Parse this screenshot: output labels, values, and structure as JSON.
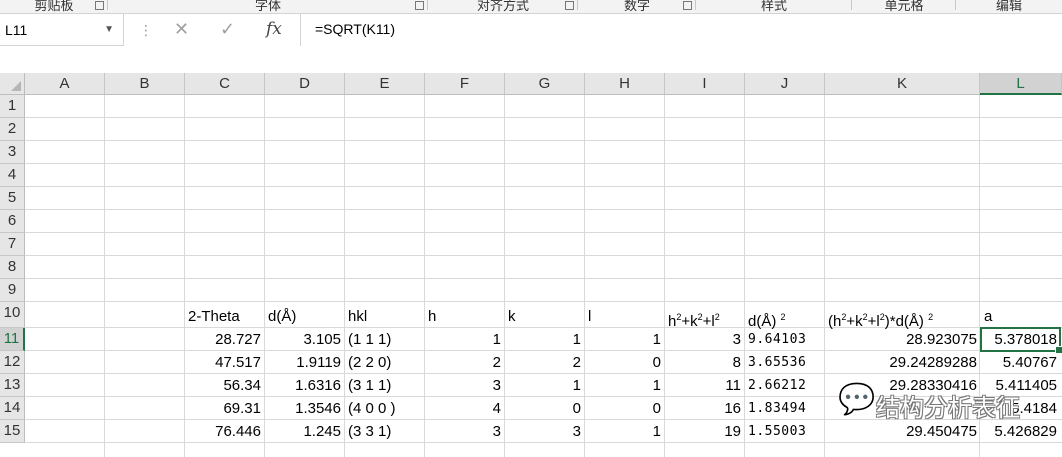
{
  "ribbon": {
    "groups": [
      {
        "label": "剪贴板"
      },
      {
        "label": "字体"
      },
      {
        "label": "对齐方式"
      },
      {
        "label": "数字"
      },
      {
        "label": "样式"
      },
      {
        "label": "单元格"
      },
      {
        "label": "编辑"
      }
    ]
  },
  "formula_bar": {
    "name_box": "L11",
    "formula": "=SQRT(K11)"
  },
  "columns": [
    "A",
    "B",
    "C",
    "D",
    "E",
    "F",
    "G",
    "H",
    "I",
    "J",
    "K",
    "L"
  ],
  "rows": [
    "1",
    "2",
    "3",
    "4",
    "5",
    "6",
    "7",
    "8",
    "9",
    "10",
    "11",
    "12",
    "13",
    "14",
    "15"
  ],
  "headers": {
    "c": "2-Theta",
    "d": "d(Å)",
    "e": "hkl",
    "f": "h",
    "g": "k",
    "h": "l",
    "i_base1": "h",
    "i_exp1": "2",
    "i_mid1": "+k",
    "i_exp2": "2",
    "i_mid2": "+l",
    "i_exp3": "2",
    "j_base": "d(Å)",
    "j_exp": "2",
    "k_pre": "(h",
    "k_exp1": "2",
    "k_mid1": "+k",
    "k_exp2": "2",
    "k_mid2": "+l",
    "k_exp3": "2",
    "k_mid3": ")*d(Å)",
    "k_exp4": "2",
    "l": "a"
  },
  "table": [
    {
      "theta": "28.727",
      "d": "3.105",
      "hkl": "(1 1 1)",
      "h": "1",
      "k": "1",
      "l": "1",
      "sum": "3",
      "d2": "9.64103",
      "prod": "28.923075",
      "a": "5.378018"
    },
    {
      "theta": "47.517",
      "d": "1.9119",
      "hkl": "(2 2 0)",
      "h": "2",
      "k": "2",
      "l": "0",
      "sum": "8",
      "d2": "3.65536",
      "prod": "29.24289288",
      "a": "5.40767"
    },
    {
      "theta": "56.34",
      "d": "1.6316",
      "hkl": "(3 1 1)",
      "h": "3",
      "k": "1",
      "l": "1",
      "sum": "11",
      "d2": "2.66212",
      "prod": "29.28330416",
      "a": "5.411405"
    },
    {
      "theta": "69.31",
      "d": "1.3546",
      "hkl": "(4 0 0 )",
      "h": "4",
      "k": "0",
      "l": "0",
      "sum": "16",
      "d2": "1.83494",
      "prod": "",
      "a": "5.4184"
    },
    {
      "theta": "76.446",
      "d": "1.245",
      "hkl": "(3 3 1)",
      "h": "3",
      "k": "3",
      "l": "1",
      "sum": "19",
      "d2": "1.55003",
      "prod": "29.450475",
      "a": "5.426829"
    }
  ],
  "watermark": {
    "text": "结构分析表征"
  },
  "colors": {
    "accent": "#217346"
  }
}
